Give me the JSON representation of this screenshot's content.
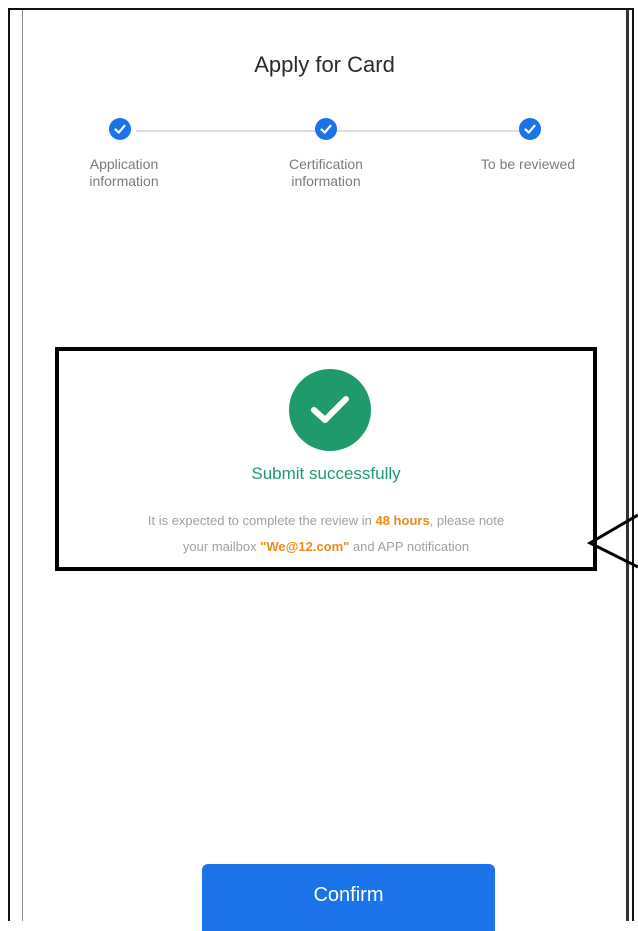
{
  "header": {
    "title": "Apply for Card"
  },
  "steps": [
    {
      "line1": "Application",
      "line2": "information",
      "status_icon": "check-icon"
    },
    {
      "line1": "Certification",
      "line2": "information",
      "status_icon": "check-icon"
    },
    {
      "line1": "To be reviewed",
      "line2": "",
      "status_icon": "check-icon"
    }
  ],
  "result": {
    "icon": "success-check-icon",
    "title": "Submit successfully",
    "desc_part1": "It is expected to complete the review in ",
    "desc_hours": "48 hours",
    "desc_part2": ", please note",
    "desc_part3": "your mailbox ",
    "desc_email": "\"We@12.com\"",
    "desc_part4": " and APP notification"
  },
  "actions": {
    "confirm_label": "Confirm"
  },
  "colors": {
    "primary_blue": "#1a73e8",
    "success_green": "#1f9a6a",
    "highlight_orange": "#ec8a1a",
    "muted_text": "#a0a0a0"
  }
}
